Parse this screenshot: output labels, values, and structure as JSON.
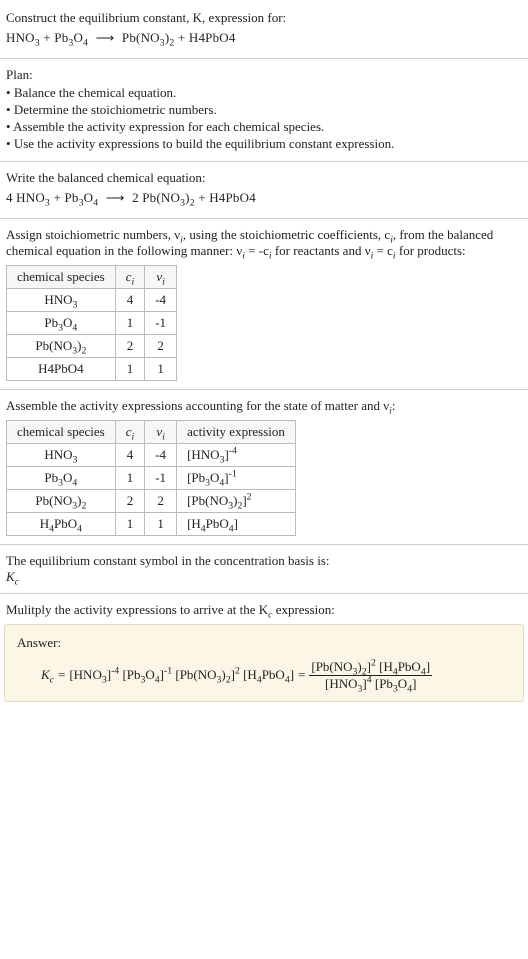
{
  "header": {
    "construct": "Construct the equilibrium constant, K, expression for:"
  },
  "reactionEq": {
    "lhs_h": "HNO",
    "lhs_h_sub": "3",
    "plus": " + ",
    "lhs_pb": "Pb",
    "lhs_pb_sub1": "3",
    "lhs_pb_mid": "O",
    "lhs_pb_sub2": "4",
    "arrow": "⟶",
    "rhs_pb": "Pb(NO",
    "rhs_pb_sub": "3",
    "rhs_pb_tail": ")",
    "rhs_pb_sub2": "2",
    "rhs_h4": "H4PbO4"
  },
  "plan": {
    "title": "Plan:",
    "items": [
      "Balance the chemical equation.",
      "Determine the stoichiometric numbers.",
      "Assemble the activity expression for each chemical species.",
      "Use the activity expressions to build the equilibrium constant expression."
    ]
  },
  "balanced": {
    "intro": "Write the balanced chemical equation:",
    "coef1": "4 ",
    "coef2": "2 "
  },
  "assign": {
    "text1": "Assign stoichiometric numbers, ν",
    "sub1": "i",
    "text2": ", using the stoichiometric coefficients, c",
    "sub2": "i",
    "text3": ", from the balanced chemical equation in the following manner: ν",
    "sub3": "i",
    "text4": " = -c",
    "sub4": "i",
    "text5": " for reactants and ν",
    "sub5": "i",
    "text6": " = c",
    "sub6": "i",
    "text7": " for products:"
  },
  "table1": {
    "h_species": "chemical species",
    "h_ci": "c",
    "h_ci_sub": "i",
    "h_vi": "ν",
    "h_vi_sub": "i",
    "rows": [
      {
        "species_a": "HNO",
        "species_sub": "3",
        "species_b": "",
        "ci": "4",
        "vi": "-4"
      },
      {
        "species_a": "Pb",
        "species_sub": "3",
        "species_b": "O",
        "species_sub2": "4",
        "ci": "1",
        "vi": "-1"
      },
      {
        "species_a": "Pb(NO",
        "species_sub": "3",
        "species_b": ")",
        "species_sub2": "2",
        "ci": "2",
        "vi": "2"
      },
      {
        "species_a": "H4PbO4",
        "species_sub": "",
        "species_b": "",
        "ci": "1",
        "vi": "1"
      }
    ]
  },
  "activityIntro": {
    "text1": "Assemble the activity expressions accounting for the state of matter and ν",
    "sub": "i",
    "text2": ":"
  },
  "table2": {
    "h_species": "chemical species",
    "h_ci": "c",
    "h_ci_sub": "i",
    "h_vi": "ν",
    "h_vi_sub": "i",
    "h_act": "activity expression",
    "rows": [
      {
        "species_a": "HNO",
        "species_sub": "3",
        "species_b": "",
        "species_sub2": "",
        "ci": "4",
        "vi": "-4",
        "act_a": "[HNO",
        "act_sub": "3",
        "act_b": "]",
        "act_sup": "-4"
      },
      {
        "species_a": "Pb",
        "species_sub": "3",
        "species_b": "O",
        "species_sub2": "4",
        "ci": "1",
        "vi": "-1",
        "act_a": "[Pb",
        "act_sub": "3",
        "act_b": "O",
        "act_sub2": "4",
        "act_c": "]",
        "act_sup": "-1"
      },
      {
        "species_a": "Pb(NO",
        "species_sub": "3",
        "species_b": ")",
        "species_sub2": "2",
        "ci": "2",
        "vi": "2",
        "act_a": "[Pb(NO",
        "act_sub": "3",
        "act_b": ")",
        "act_sub2": "2",
        "act_c": "]",
        "act_sup": "2"
      },
      {
        "species_a": "H",
        "species_sub": "4",
        "species_b": "PbO",
        "species_sub2": "4",
        "ci": "1",
        "vi": "1",
        "act_a": "[H",
        "act_sub": "4",
        "act_b": "PbO",
        "act_sub2": "4",
        "act_c": "]",
        "act_sup": ""
      }
    ]
  },
  "eqconst": {
    "line1": "The equilibrium constant symbol in the concentration basis is:",
    "sym": "K",
    "sym_sub": "c"
  },
  "multiply": {
    "text1": "Mulitply the activity expressions to arrive at the K",
    "sub": "c",
    "text2": " expression:"
  },
  "answer": {
    "label": "Answer:",
    "Kc": "K",
    "Kc_sub": "c",
    "eq": " = ",
    "t1": "[HNO",
    "t1s": "3",
    "t1b": "]",
    "t1sup": "-4",
    "t2": " [Pb",
    "t2s": "3",
    "t2m": "O",
    "t2s2": "4",
    "t2b": "]",
    "t2sup": "-1",
    "t3": " [Pb(NO",
    "t3s": "3",
    "t3m": ")",
    "t3s2": "2",
    "t3b": "]",
    "t3sup": "2",
    "t4": " [H",
    "t4s": "4",
    "t4m": "PbO",
    "t4s2": "4",
    "t4b": "]",
    "eq2": " = ",
    "num1": "[Pb(NO",
    "num1s": "3",
    "num1m": ")",
    "num1s2": "2",
    "num1b": "]",
    "num1sup": "2",
    "num2": " [H",
    "num2s": "4",
    "num2m": "PbO",
    "num2s2": "4",
    "num2b": "]",
    "den1": "[HNO",
    "den1s": "3",
    "den1b": "]",
    "den1sup": "4",
    "den2": " [Pb",
    "den2s": "3",
    "den2m": "O",
    "den2s2": "4",
    "den2b": "]"
  }
}
